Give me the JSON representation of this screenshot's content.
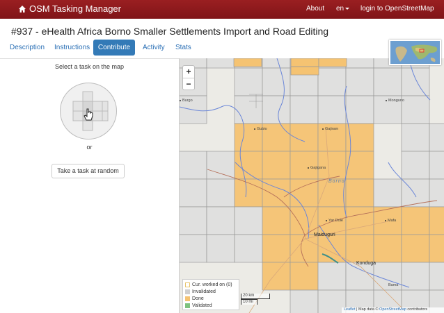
{
  "navbar": {
    "brand": "OSM Tasking Manager",
    "about": "About",
    "language": "en",
    "login": "login to OpenStreetMap"
  },
  "project": {
    "title": "#937 - eHealth Africa Borno Smaller Settlements Import and Road Editing"
  },
  "tabs": [
    {
      "label": "Description"
    },
    {
      "label": "Instructions"
    },
    {
      "label": "Contribute"
    },
    {
      "label": "Activity"
    },
    {
      "label": "Stats"
    }
  ],
  "contribute": {
    "select_text": "Select a task on the map",
    "or_text": "or",
    "random_button": "Take a task at random"
  },
  "map": {
    "zoom_in": "+",
    "zoom_out": "−",
    "places": {
      "burgo": "Burgo",
      "monguno": "Monguno",
      "gubio": "Gubio",
      "gajiram": "Gajiram",
      "gajigana": "Gajigana",
      "borno": "Borno",
      "yar_dole": "Yar Dole",
      "mafa": "Mafa",
      "maiduguri": "Maiduguri",
      "konduga": "Konduga",
      "bama": "Bama"
    },
    "legend": [
      {
        "label": "Cur. worked on (0)",
        "color": "#ffffff",
        "border": "#e8c46a"
      },
      {
        "label": "Invalidated",
        "color": "#cfcfcf",
        "border": "#cfcfcf"
      },
      {
        "label": "Done",
        "color": "#f5c372",
        "border": "#f5c372"
      },
      {
        "label": "Validated",
        "color": "#7ec27e",
        "border": "#7ec27e"
      }
    ],
    "scale_km": "20 km",
    "scale_mi": "10 mi",
    "attribution_leaflet": "Leaflet",
    "attribution_text": " | Map data © ",
    "attribution_osm": "OpenStreetMap",
    "attribution_tail": " contributors"
  },
  "colors": {
    "navbar": "#8b1a1a",
    "accent": "#337ab7",
    "done": "#f5c372",
    "invalidated": "#dcdcdc",
    "river": "#6a86d8",
    "boundary": "#b5705a"
  }
}
